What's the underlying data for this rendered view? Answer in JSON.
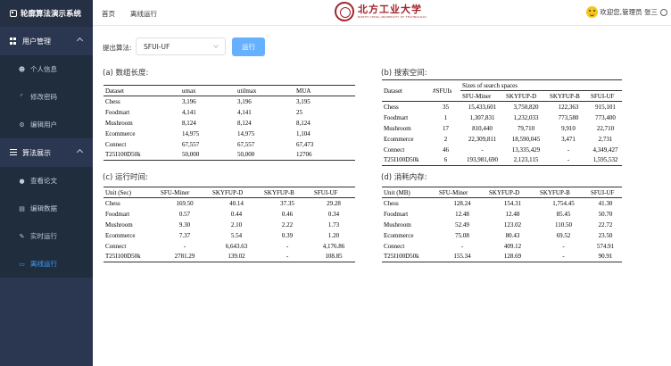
{
  "app": {
    "title": "轮廓算法演示系统"
  },
  "sidebar": {
    "groups": [
      {
        "label": "用户管理",
        "items": [
          {
            "label": "个人信息",
            "icon": "user-icon"
          },
          {
            "label": "修改密码",
            "icon": "crop-icon"
          },
          {
            "label": "编辑用户",
            "icon": "gear-icon"
          }
        ]
      },
      {
        "label": "算法展示",
        "items": [
          {
            "label": "查看论文",
            "icon": "location-icon"
          },
          {
            "label": "编辑数据",
            "icon": "document-icon"
          },
          {
            "label": "实时运行",
            "icon": "edit-icon"
          },
          {
            "label": "离线运行",
            "icon": "monitor-icon",
            "active": true
          }
        ]
      }
    ]
  },
  "header": {
    "nav": [
      "首页",
      "离线运行"
    ],
    "university_cn": "北方工业大学",
    "university_en": "NORTH CHINA UNIVERSITY OF TECHNOLOGY",
    "welcome": "欢迎您,管理员 张三"
  },
  "toolbar": {
    "label": "提出算法:",
    "selected": "SFUI-UF",
    "run_label": "运行"
  },
  "sections": {
    "a": {
      "title": "(a) 数组长度:",
      "headers": [
        "Dataset",
        "umax",
        "utilmax",
        "MUA"
      ],
      "rows": [
        [
          "Chess",
          "3,196",
          "3,196",
          "3,195"
        ],
        [
          "Foodmart",
          "4,141",
          "4,141",
          "25"
        ],
        [
          "Mushroom",
          "8,124",
          "8,124",
          "8,124"
        ],
        [
          "Ecommerce",
          "14,975",
          "14,975",
          "1,104"
        ],
        [
          "Connect",
          "67,557",
          "67,557",
          "67,473"
        ],
        [
          "T25I100D50k",
          "50,000",
          "50,000",
          "12706"
        ]
      ]
    },
    "b": {
      "title": "(b) 搜索空间:",
      "headers": [
        "Dataset",
        "#SFUIs",
        "Sizes of search spaces"
      ],
      "subheaders": [
        "SFU-Miner",
        "SKYFUP-D",
        "SKYFUP-B",
        "SFUI-UF"
      ],
      "rows": [
        [
          "Chess",
          "35",
          "15,433,601",
          "3,750,820",
          "122,363",
          "915,101"
        ],
        [
          "Foodmart",
          "1",
          "1,307,831",
          "1,232,033",
          "773,580",
          "773,400"
        ],
        [
          "Mushroom",
          "17",
          "810,440",
          "79,710",
          "9,910",
          "22,710"
        ],
        [
          "Ecommerce",
          "2",
          "22,309,811",
          "18,590,045",
          "3,471",
          "2,731"
        ],
        [
          "Connect",
          "46",
          "-",
          "13,335,429",
          "-",
          "4,349,427"
        ],
        [
          "T25I100D50k",
          "6",
          "193,981,690",
          "2,123,115",
          "-",
          "1,595,532"
        ]
      ]
    },
    "c": {
      "title": "(c) 运行时间:",
      "headers": [
        "Unit (Sec)",
        "SFU-Miner",
        "SKYFUP-D",
        "SKYFUP-B",
        "SFUI-UF"
      ],
      "rows": [
        [
          "Chess",
          "169.50",
          "40.14",
          "37.35",
          "29.28"
        ],
        [
          "Foodmart",
          "0.57",
          "0.44",
          "0.46",
          "0.34"
        ],
        [
          "Mushroom",
          "9.30",
          "2.10",
          "2.22",
          "1.73"
        ],
        [
          "Ecommerce",
          "7.37",
          "5.54",
          "0.39",
          "1.20"
        ],
        [
          "Connect",
          "-",
          "6,643.63",
          "-",
          "4,176.86"
        ],
        [
          "T25I100D50k",
          "2781.29",
          "139.02",
          "-",
          "108.85"
        ]
      ]
    },
    "d": {
      "title": "(d) 消耗内存:",
      "headers": [
        "Unit (MB)",
        "SFU-Miner",
        "SKYFUP-D",
        "SKYFUP-B",
        "SFUI-UF"
      ],
      "rows": [
        [
          "Chess",
          "128.24",
          "154.31",
          "1,754.45",
          "41.30"
        ],
        [
          "Foodmart",
          "12.48",
          "12.48",
          "85.45",
          "50.70"
        ],
        [
          "Mushroom",
          "52.49",
          "123.02",
          "110.50",
          "22.72"
        ],
        [
          "Ecommerce",
          "75.08",
          "80.43",
          "69.52",
          "23.50"
        ],
        [
          "Connect",
          "-",
          "409.12",
          "-",
          "574.91"
        ],
        [
          "T25I100D50k",
          "155.34",
          "128.69",
          "-",
          "90.91"
        ]
      ]
    }
  },
  "colors": {
    "sidebar_bg": "#2b3750",
    "accent": "#409eff",
    "brand_red": "#a1252b"
  }
}
